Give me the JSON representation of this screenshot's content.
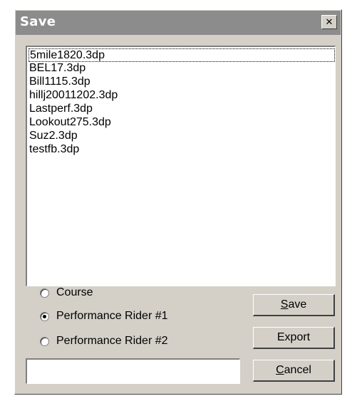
{
  "window": {
    "title": "Save",
    "close_glyph": "✕"
  },
  "files": [
    "5mile1820.3dp",
    "BEL17.3dp",
    "Bill1115.3dp",
    "hillj20011202.3dp",
    "Lastperf.3dp",
    "Lookout275.3dp",
    "Suz2.3dp",
    "testfb.3dp"
  ],
  "focused_file_index": 0,
  "radio_options": [
    {
      "label": "Course",
      "checked": false
    },
    {
      "label": "Performance Rider #1",
      "checked": true
    },
    {
      "label": "Performance Rider #2",
      "checked": false
    }
  ],
  "buttons": {
    "save": {
      "mnemonic": "S",
      "rest": "ave"
    },
    "export": {
      "label": "Export"
    },
    "cancel": {
      "mnemonic": "C",
      "rest": "ancel"
    }
  },
  "filename_input": {
    "value": "",
    "placeholder": ""
  },
  "icons": {
    "close": "close-icon",
    "radio_selected": "radio-selected-icon"
  }
}
